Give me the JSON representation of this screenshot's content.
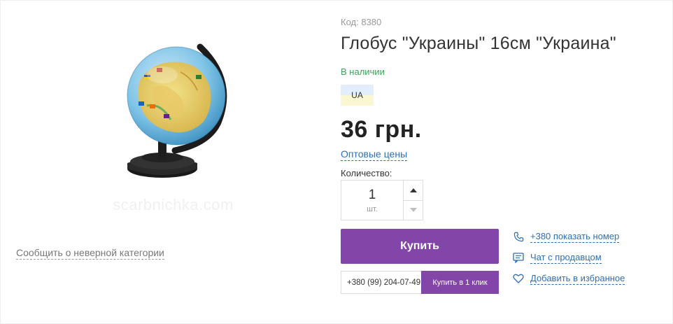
{
  "product": {
    "sku": "Код: 8380",
    "title": "Глобус \"Украины\" 16см \"Украина\"",
    "stock": "В наличии",
    "lang_badge": "UA",
    "price": "36 грн.",
    "wholesale_link": "Оптовые цены",
    "image_watermark": "scarbnichka.com"
  },
  "quantity": {
    "label": "Количество:",
    "value": "1",
    "unit": "шт."
  },
  "actions": {
    "buy_label": "Купить",
    "phone_value": "+380 (99) 204-07-49",
    "one_click_label": "Купить в 1 клик"
  },
  "side_links": {
    "phone": "+380 показать номер",
    "chat": "Чат с продавцом",
    "favorite": "Добавить в избранное"
  },
  "report_link": "Сообщить о неверной категории",
  "colors": {
    "accent": "#8146a7",
    "link": "#2f6fb1",
    "in_stock": "#3aa55a"
  },
  "icons": {
    "phone": "phone-icon",
    "chat": "chat-icon",
    "favorite": "heart-icon",
    "qty_up": "caret-up-icon",
    "qty_down": "caret-down-icon"
  }
}
